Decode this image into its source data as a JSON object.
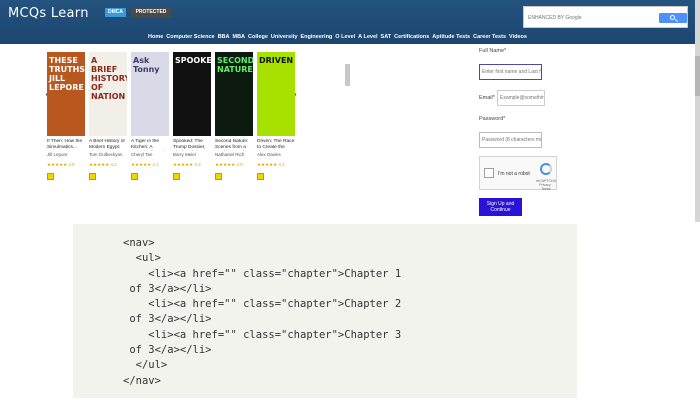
{
  "header": {
    "logo": "MCQs Learn",
    "badges": [
      "DMCA",
      "PROTECTED"
    ],
    "search": {
      "placeholder": "ENHANCED BY Google"
    },
    "nav": [
      "Home",
      "Computer Science",
      "BBA",
      "MBA",
      "College",
      "University",
      "Engineering",
      "O Level",
      "A Level",
      "SAT",
      "Certifications",
      "Aptitude Tests",
      "Career Tests",
      "Videos"
    ]
  },
  "books": [
    {
      "cover_text": "THESE TRUTHS JILL LEPORE",
      "cover_color": "#b8581e",
      "text_color": "#ffffff",
      "title": "If Then: How the Simulmatics...",
      "author": "Jill Lepore",
      "rating": "★★★★★ 4.5"
    },
    {
      "cover_text": "A BRIEF HISTORY OF NATION",
      "cover_color": "#f2efe8",
      "text_color": "#8a2a1a",
      "title": "A Brief History of Modern Egypt: The...",
      "author": "Tom Gulbeckyan",
      "rating": "★★★★★ 4.2"
    },
    {
      "cover_text": "Ask Tonny",
      "cover_color": "#d9d9e8",
      "text_color": "#3a3a6a",
      "title": "A Tiger in the Kitchen: A Memoir of Food and...",
      "author": "Cheryl Tan",
      "rating": "★★★★★ 4.1"
    },
    {
      "cover_text": "SPOOKED",
      "cover_color": "#111111",
      "text_color": "#ffffff",
      "title": "Spooked: The Trump Dossier, Black Cube, and...",
      "author": "Barry Meier",
      "rating": "★★★★★ 4.3"
    },
    {
      "cover_text": "SECOND NATURE",
      "cover_color": "#0c1a10",
      "text_color": "#5cf06a",
      "title": "Second Nature: Scenes from a World Remade",
      "author": "Nathaniel Rich",
      "rating": "★★★★★ 4.0"
    },
    {
      "cover_text": "DRIVEN",
      "cover_color": "#a8e000",
      "text_color": "#111111",
      "title": "Driven: The Race to Create the Autonomous Car",
      "author": "Alex Davies",
      "rating": "★★★★★ 4.4"
    }
  ],
  "form": {
    "fullname_label": "Full Name*",
    "fullname_placeholder": "Enter first name and Last Name",
    "email_label": "Email*",
    "email_placeholder": "Example@something.com",
    "password_label": "Password*",
    "password_placeholder": "Password (8 characters minimum)",
    "captcha_label": "I'm not a robot",
    "captcha_brand": "reCAPTCHA Privacy - Terms",
    "submit_label": "Sign Up and Continue"
  },
  "code": "<nav>\n  <ul>\n    <li><a href=\"\" class=\"chapter\">Chapter 1\n of 3</a></li>\n    <li><a href=\"\" class=\"chapter\">Chapter 2\n of 3</a></li>\n    <li><a href=\"\" class=\"chapter\">Chapter 3\n of 3</a></li>\n  </ul>\n</nav>"
}
